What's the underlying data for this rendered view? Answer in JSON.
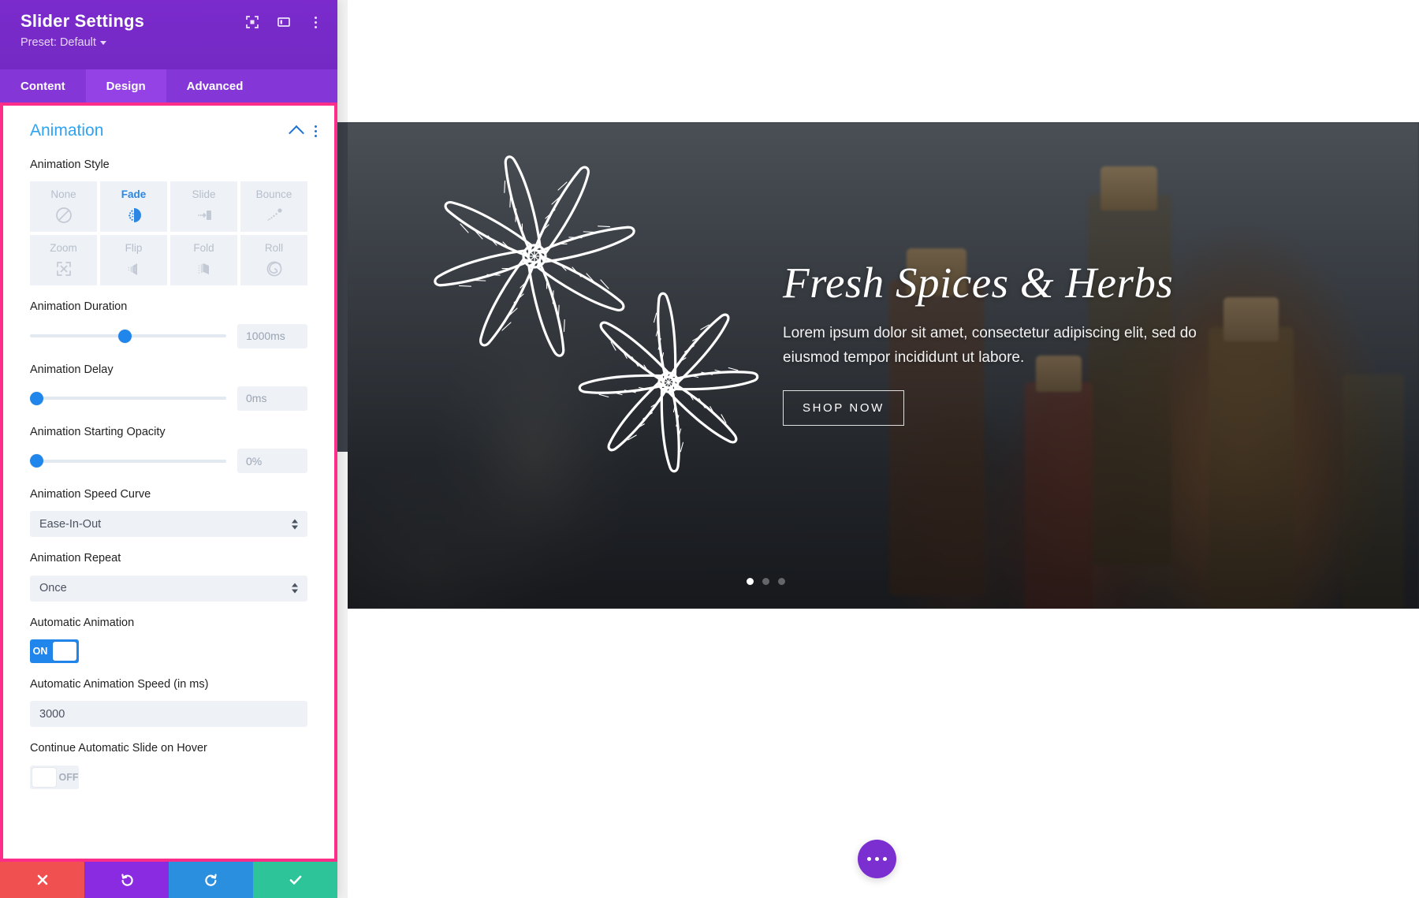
{
  "panel": {
    "title": "Slider Settings",
    "preset_label": "Preset: Default",
    "header_icons": [
      {
        "name": "focus-icon",
        "glyph": "focus"
      },
      {
        "name": "layout-panel-icon",
        "glyph": "layout"
      },
      {
        "name": "more-options-icon",
        "glyph": "kebab"
      }
    ],
    "tabs": [
      {
        "label": "Content",
        "active": false
      },
      {
        "label": "Design",
        "active": true
      },
      {
        "label": "Advanced",
        "active": false
      }
    ],
    "section": {
      "title": "Animation",
      "collapse_icon": "chevron-up-icon",
      "menu_icon": "more-options-icon"
    },
    "fields": {
      "animation_style": {
        "label": "Animation Style",
        "options": [
          {
            "label": "None",
            "icon": "no-entry-icon",
            "selected": false
          },
          {
            "label": "Fade",
            "icon": "fade-icon",
            "selected": true
          },
          {
            "label": "Slide",
            "icon": "slide-icon",
            "selected": false
          },
          {
            "label": "Bounce",
            "icon": "bounce-icon",
            "selected": false
          },
          {
            "label": "Zoom",
            "icon": "zoom-icon",
            "selected": false
          },
          {
            "label": "Flip",
            "icon": "flip-icon",
            "selected": false
          },
          {
            "label": "Fold",
            "icon": "fold-icon",
            "selected": false
          },
          {
            "label": "Roll",
            "icon": "roll-icon",
            "selected": false
          }
        ]
      },
      "animation_duration": {
        "label": "Animation Duration",
        "value": "1000ms",
        "knob_percent": 48
      },
      "animation_delay": {
        "label": "Animation Delay",
        "value": "0ms",
        "knob_percent": 0
      },
      "animation_starting_opacity": {
        "label": "Animation Starting Opacity",
        "value": "0%",
        "knob_percent": 0
      },
      "animation_speed_curve": {
        "label": "Animation Speed Curve",
        "value": "Ease-In-Out"
      },
      "animation_repeat": {
        "label": "Animation Repeat",
        "value": "Once"
      },
      "automatic_animation": {
        "label": "Automatic Animation",
        "state": "ON"
      },
      "automatic_animation_speed": {
        "label": "Automatic Animation Speed (in ms)",
        "value": "3000"
      },
      "continue_on_hover": {
        "label": "Continue Automatic Slide on Hover",
        "state": "OFF"
      }
    },
    "footer": [
      {
        "name": "cancel-button",
        "icon": "close-icon"
      },
      {
        "name": "undo-button",
        "icon": "undo-icon"
      },
      {
        "name": "redo-button",
        "icon": "redo-icon"
      },
      {
        "name": "save-button",
        "icon": "check-icon"
      }
    ]
  },
  "slider": {
    "title": "Fresh Spices & Herbs",
    "body": "Lorem ipsum dolor sit amet, consectetur adipiscing elit, sed do eiusmod tempor incididunt ut labore.",
    "button_label": "SHOP NOW",
    "dots": [
      {
        "active": true
      },
      {
        "active": false
      },
      {
        "active": false
      }
    ]
  },
  "page_fab": {
    "name": "page-settings-button",
    "icon": "ellipsis-icon"
  },
  "colors": {
    "panel_header": "#7b2bcc",
    "tab_active": "#9442e6",
    "accent_blue": "#2186eb",
    "section_title": "#2ea3f2",
    "highlight_border": "#ff2d8a",
    "footer_cancel": "#f05050",
    "footer_undo": "#8a2be2",
    "footer_redo": "#2b8fe0",
    "footer_save": "#2dc49a",
    "fab": "#7b2fd1"
  }
}
